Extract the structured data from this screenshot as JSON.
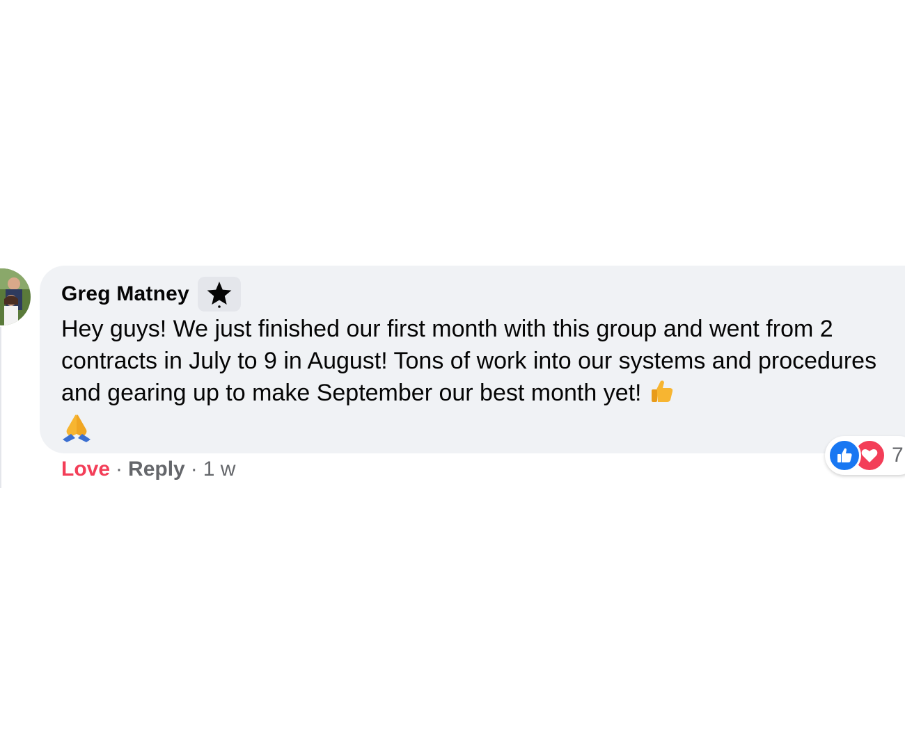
{
  "comment": {
    "author": "Greg Matney",
    "badge_icon": "star-icon",
    "text": "Hey guys! We just finished our first month with this group and went from 2 contracts in July to 9 in August! Tons of work into our systems and procedures and gearing up to make September our best month yet!",
    "emojis": [
      "thumbs-up-icon",
      "folded-hands-icon"
    ]
  },
  "actions": {
    "love_label": "Love",
    "separator": "·",
    "reply_label": "Reply",
    "timestamp": "1 w"
  },
  "reactions": {
    "icons": [
      "like-icon",
      "heart-icon"
    ],
    "count": "7"
  },
  "colors": {
    "bubble": "#f0f2f5",
    "love_active": "#f33e58",
    "like_blue": "#1877f2",
    "secondary_text": "#65676b"
  }
}
